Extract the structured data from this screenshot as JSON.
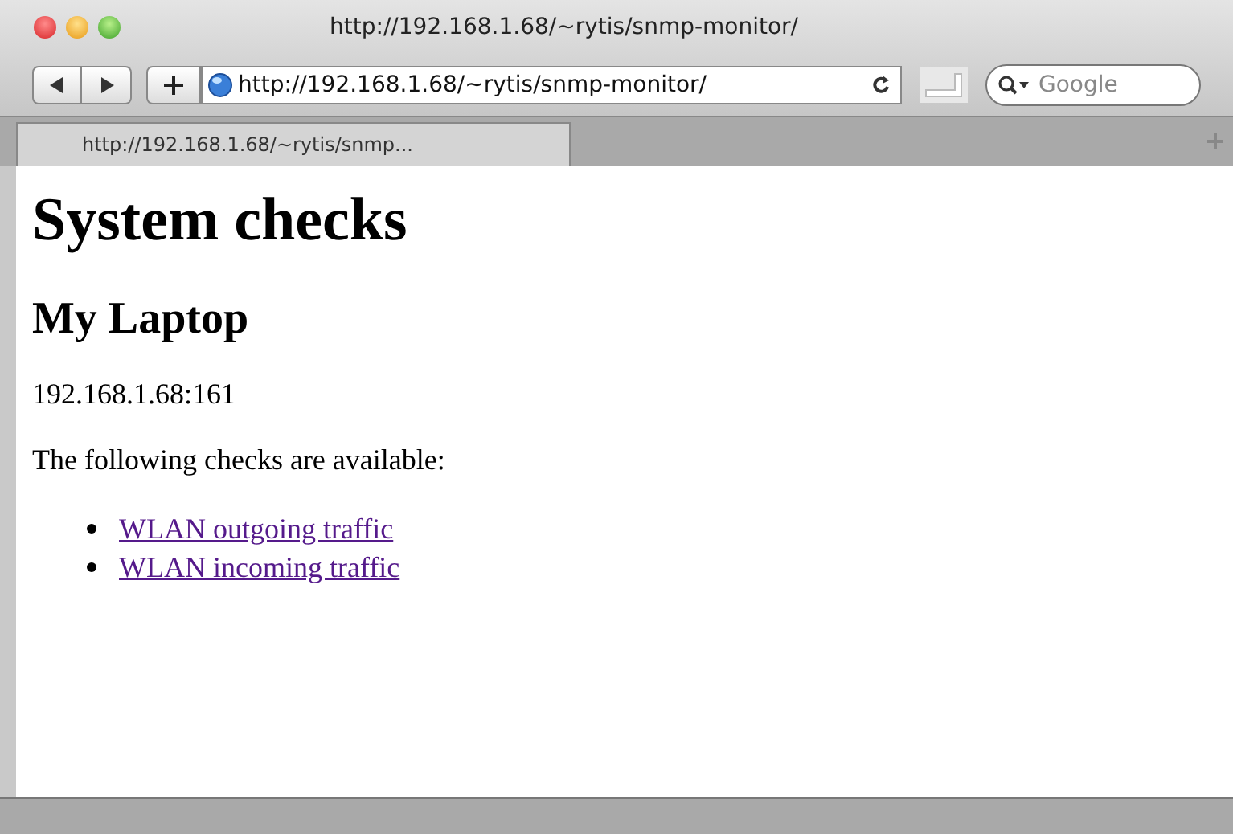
{
  "window": {
    "title": "http://192.168.1.68/~rytis/snmp-monitor/"
  },
  "toolbar": {
    "address": "http://192.168.1.68/~rytis/snmp-monitor/",
    "search": {
      "placeholder": "Google"
    }
  },
  "tabs": [
    {
      "label": "http://192.168.1.68/~rytis/snmp...",
      "selected": true
    }
  ],
  "page": {
    "heading": "System checks",
    "subheading": "My Laptop",
    "address": "192.168.1.68:161",
    "intro": "The following checks are available:",
    "links": [
      {
        "label": "WLAN outgoing traffic"
      },
      {
        "label": "WLAN incoming traffic"
      }
    ]
  }
}
